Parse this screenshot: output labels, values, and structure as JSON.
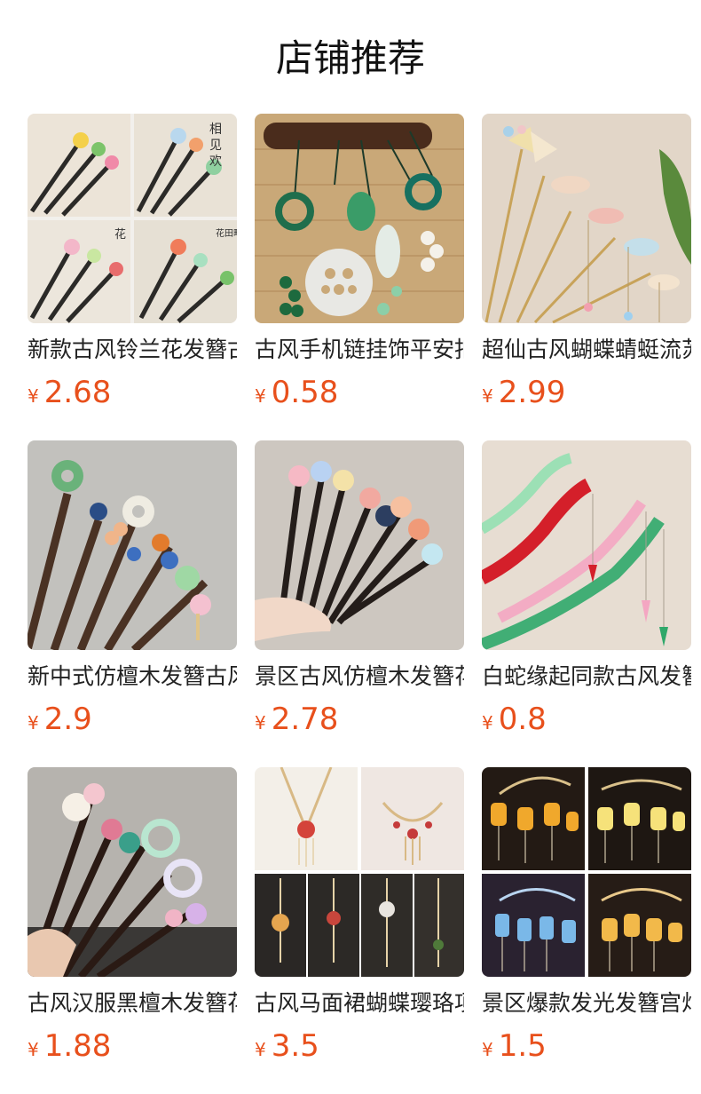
{
  "page": {
    "title": "店铺推荐"
  },
  "currency_symbol": "¥",
  "products": [
    {
      "name": "新款古风铃兰花发簪古风",
      "price": "2.68",
      "image": "hairpin-collage-image"
    },
    {
      "name": "古风手机链挂饰平安扣",
      "price": "0.58",
      "image": "jade-phone-charm-image"
    },
    {
      "name": "超仙古风蝴蝶蜻蜓流苏",
      "price": "2.99",
      "image": "butterfly-hairpin-image"
    },
    {
      "name": "新中式仿檀木发簪古风",
      "price": "2.9",
      "image": "sandalwood-hairpin-image"
    },
    {
      "name": "景区古风仿檀木发簪花",
      "price": "2.78",
      "image": "flower-hairpin-hand-image"
    },
    {
      "name": "白蛇缘起同款古风发簪",
      "price": "0.8",
      "image": "acrylic-hairpin-image"
    },
    {
      "name": "古风汉服黑檀木发簪花",
      "price": "1.88",
      "image": "ebony-hairpin-image"
    },
    {
      "name": "古风马面裙蝴蝶璎珞项圈",
      "price": "3.5",
      "image": "necklace-collage-image"
    },
    {
      "name": "景区爆款发光发簪宫灯",
      "price": "1.5",
      "image": "glowing-hairpin-image"
    }
  ],
  "colors": {
    "price": "#e8501c",
    "text": "#222222"
  }
}
